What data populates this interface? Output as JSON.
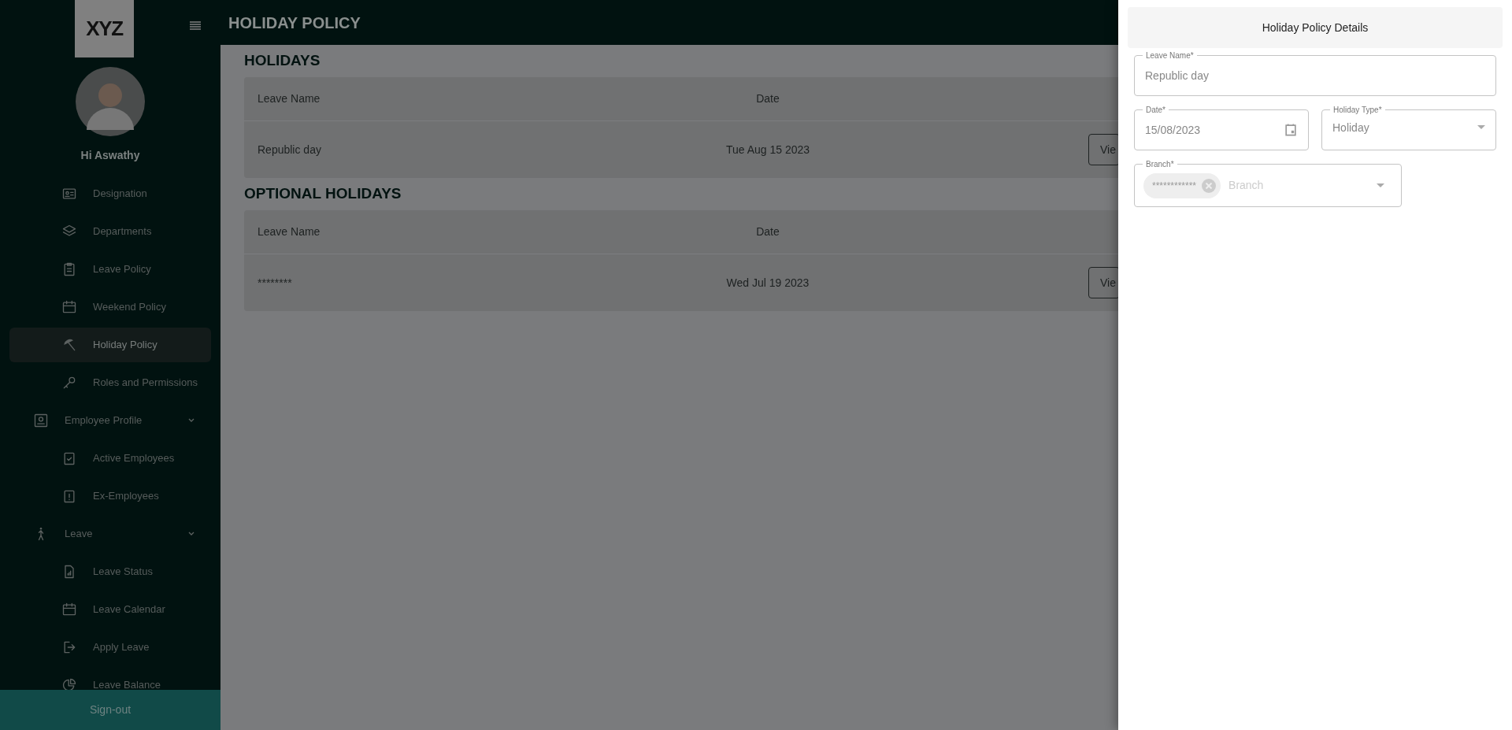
{
  "sidebar": {
    "logo": "XYZ",
    "greeting": "Hi Aswathy",
    "items": [
      {
        "label": "Designation",
        "kind": "idcard",
        "selected": false
      },
      {
        "label": "Departments",
        "kind": "layers",
        "selected": false
      },
      {
        "label": "Leave Policy",
        "kind": "clipboard",
        "selected": false
      },
      {
        "label": "Weekend Policy",
        "kind": "calendar",
        "selected": false
      },
      {
        "label": "Holiday Policy",
        "kind": "umbrella",
        "selected": true
      },
      {
        "label": "Roles and Permissions",
        "kind": "key",
        "selected": false
      },
      {
        "label": "Employee Profile",
        "kind": "profile",
        "selected": false,
        "expanded": true,
        "children": [
          {
            "label": "Active Employees",
            "kind": "check",
            "selected": false
          },
          {
            "label": "Ex-Employees",
            "kind": "alert",
            "selected": false
          }
        ]
      },
      {
        "label": "Leave",
        "kind": "walk",
        "selected": false,
        "expanded": true,
        "children": [
          {
            "label": "Leave Status",
            "kind": "chart",
            "selected": false
          },
          {
            "label": "Leave Calendar",
            "kind": "calendar",
            "selected": false
          },
          {
            "label": "Apply Leave",
            "kind": "exit",
            "selected": false
          },
          {
            "label": "Leave Balance",
            "kind": "pie",
            "selected": false
          }
        ]
      }
    ],
    "signout": "Sign-out"
  },
  "header": {
    "title": "HOLIDAY POLICY"
  },
  "sections": [
    {
      "title": "HOLIDAYS",
      "columns": [
        "Leave Name",
        "Date"
      ],
      "rows": [
        {
          "name": "Republic day",
          "date": "Tue Aug 15 2023",
          "action": "Vie"
        }
      ]
    },
    {
      "title": "OPTIONAL HOLIDAYS",
      "columns": [
        "Leave Name",
        "Date"
      ],
      "rows": [
        {
          "name": "********",
          "date": "Wed Jul 19 2023",
          "action": "Vie"
        }
      ]
    }
  ],
  "drawer": {
    "title": "Holiday Policy Details",
    "leave_name": {
      "label": "Leave Name*",
      "value": "Republic day"
    },
    "date": {
      "label": "Date*",
      "value": "15/08/2023"
    },
    "holiday_type": {
      "label": "Holiday Type*",
      "value": "Holiday"
    },
    "branch": {
      "label": "Branch*",
      "chip": "************",
      "placeholder": "Branch"
    }
  }
}
